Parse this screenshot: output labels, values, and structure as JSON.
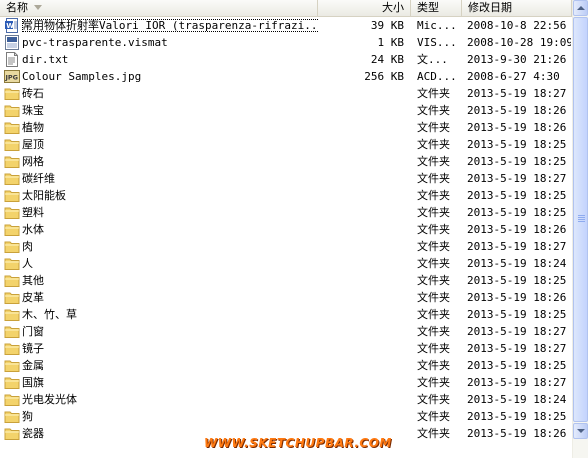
{
  "columns": {
    "name": "名称",
    "size": "大小",
    "type": "类型",
    "date": "修改日期"
  },
  "files": [
    {
      "name": "常用物体折射率Valori IOR (trasparenza-rifrazi...",
      "size": "39 KB",
      "type": "Mic...",
      "date": "2008-10-8 22:56",
      "icon": "word-doc-icon",
      "selected": true
    },
    {
      "name": "pvc-trasparente.vismat",
      "size": "1 KB",
      "type": "VIS...",
      "date": "2008-10-28 19:09",
      "icon": "vismat-file-icon"
    },
    {
      "name": "dir.txt",
      "size": "24 KB",
      "type": "文...",
      "date": "2013-9-30 21:26",
      "icon": "text-file-icon"
    },
    {
      "name": "Colour Samples.jpg",
      "size": "256 KB",
      "type": "ACD...",
      "date": "2008-6-27 4:30",
      "icon": "jpg-file-icon"
    },
    {
      "name": "砖石",
      "size": "",
      "type": "文件夹",
      "date": "2013-5-19 18:27",
      "icon": "folder-icon"
    },
    {
      "name": "珠宝",
      "size": "",
      "type": "文件夹",
      "date": "2013-5-19 18:26",
      "icon": "folder-icon"
    },
    {
      "name": "植物",
      "size": "",
      "type": "文件夹",
      "date": "2013-5-19 18:26",
      "icon": "folder-icon"
    },
    {
      "name": "屋顶",
      "size": "",
      "type": "文件夹",
      "date": "2013-5-19 18:25",
      "icon": "folder-icon"
    },
    {
      "name": "网格",
      "size": "",
      "type": "文件夹",
      "date": "2013-5-19 18:25",
      "icon": "folder-icon"
    },
    {
      "name": "碳纤维",
      "size": "",
      "type": "文件夹",
      "date": "2013-5-19 18:27",
      "icon": "folder-icon"
    },
    {
      "name": "太阳能板",
      "size": "",
      "type": "文件夹",
      "date": "2013-5-19 18:25",
      "icon": "folder-icon"
    },
    {
      "name": "塑料",
      "size": "",
      "type": "文件夹",
      "date": "2013-5-19 18:25",
      "icon": "folder-icon"
    },
    {
      "name": "水体",
      "size": "",
      "type": "文件夹",
      "date": "2013-5-19 18:26",
      "icon": "folder-icon"
    },
    {
      "name": "肉",
      "size": "",
      "type": "文件夹",
      "date": "2013-5-19 18:27",
      "icon": "folder-icon"
    },
    {
      "name": "人",
      "size": "",
      "type": "文件夹",
      "date": "2013-5-19 18:24",
      "icon": "folder-icon"
    },
    {
      "name": "其他",
      "size": "",
      "type": "文件夹",
      "date": "2013-5-19 18:25",
      "icon": "folder-icon"
    },
    {
      "name": "皮革",
      "size": "",
      "type": "文件夹",
      "date": "2013-5-19 18:26",
      "icon": "folder-icon"
    },
    {
      "name": "木、竹、草",
      "size": "",
      "type": "文件夹",
      "date": "2013-5-19 18:25",
      "icon": "folder-icon"
    },
    {
      "name": "门窗",
      "size": "",
      "type": "文件夹",
      "date": "2013-5-19 18:27",
      "icon": "folder-icon"
    },
    {
      "name": "镜子",
      "size": "",
      "type": "文件夹",
      "date": "2013-5-19 18:27",
      "icon": "folder-icon"
    },
    {
      "name": "金属",
      "size": "",
      "type": "文件夹",
      "date": "2013-5-19 18:25",
      "icon": "folder-icon"
    },
    {
      "name": "国旗",
      "size": "",
      "type": "文件夹",
      "date": "2013-5-19 18:27",
      "icon": "folder-icon"
    },
    {
      "name": "光电发光体",
      "size": "",
      "type": "文件夹",
      "date": "2013-5-19 18:24",
      "icon": "folder-icon"
    },
    {
      "name": "狗",
      "size": "",
      "type": "文件夹",
      "date": "2013-5-19 18:25",
      "icon": "folder-icon"
    },
    {
      "name": "瓷器",
      "size": "",
      "type": "文件夹",
      "date": "2013-5-19 18:26",
      "icon": "folder-icon"
    }
  ],
  "watermark": "WWW.SKETCHUPBAR.COM",
  "colors": {
    "folder": "#f3d36b",
    "folder_dark": "#c9a13a",
    "watermark": "#ff7a12",
    "scrollbar": "#c3d3fd"
  }
}
